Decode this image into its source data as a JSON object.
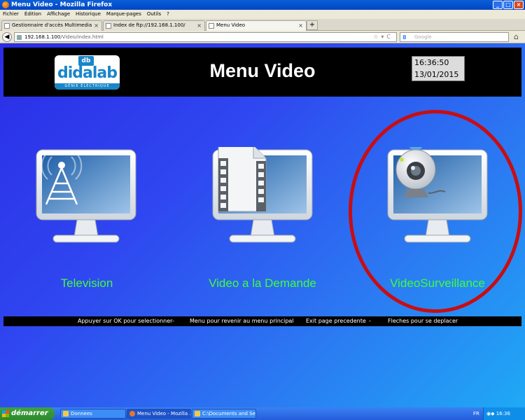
{
  "browser": {
    "window_title": "Menu Video - Mozilla Firefox",
    "menu": [
      "Fichier",
      "Édition",
      "Affichage",
      "Historique",
      "Marque-pages",
      "Outils",
      "?"
    ],
    "tabs": [
      {
        "label": "Gestionnaire d'accès Multimedia"
      },
      {
        "label": "Index de ftp://192.168.1.100/"
      },
      {
        "label": "Menu Video"
      }
    ],
    "new_tab": "+",
    "url_host": "192.168.1.100",
    "url_path": "/Video/index.html",
    "search_placeholder": "Google"
  },
  "page": {
    "logo": {
      "mark": "db",
      "name": "didalab",
      "sub": "GÉNIE ÉLECTRIQUE"
    },
    "title": "Menu Video",
    "time": "16:36:50",
    "date": "13/01/2015",
    "tiles": [
      {
        "label": "Television",
        "icon": "tv-antenna-icon"
      },
      {
        "label": "Video a la Demande",
        "icon": "film-file-icon"
      },
      {
        "label": "VideoSurveillance",
        "icon": "webcam-icon"
      }
    ],
    "footer": [
      "Appuyer sur OK pour selectionner",
      "-",
      "Menu pour revenir au menu principal",
      "-",
      "Exit page precedente",
      "-",
      "Fleches pour se deplacer"
    ],
    "highlight_color": "#c80d12"
  },
  "taskbar": {
    "start": "démarrer",
    "tasks": [
      {
        "label": "Donnees"
      },
      {
        "label": "Menu Video - Mozilla ..."
      },
      {
        "label": "C:\\Documents and Se..."
      }
    ],
    "lang": "FR",
    "clock": "16:36"
  }
}
